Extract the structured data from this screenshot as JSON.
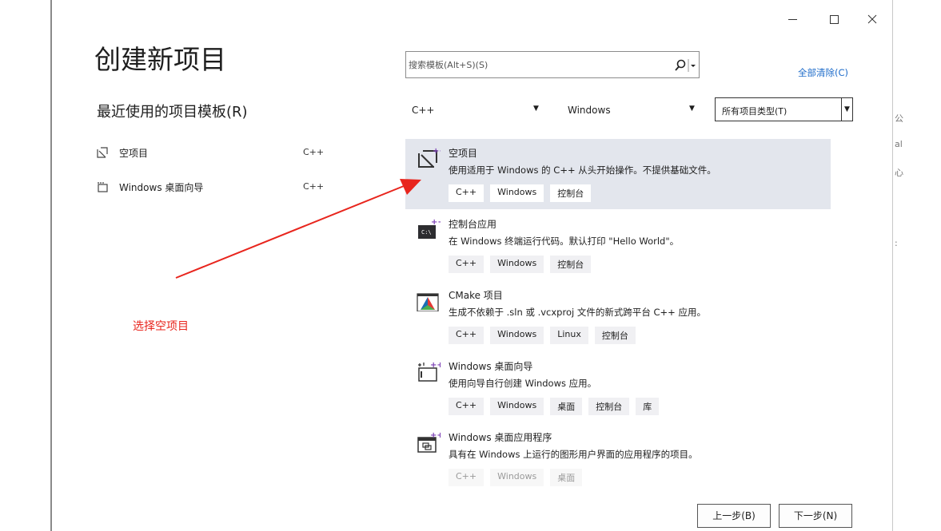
{
  "header": {
    "title": "创建新项目"
  },
  "recent": {
    "title": "最近使用的项目模板(R)",
    "items": [
      {
        "label": "空项目",
        "lang": "C++",
        "icon": "empty-project-icon"
      },
      {
        "label": "Windows 桌面向导",
        "lang": "C++",
        "icon": "desktop-wizard-icon"
      }
    ]
  },
  "search": {
    "placeholder": "搜索模板(Alt+S)(S)",
    "value": ""
  },
  "clear_all": "全部清除(C)",
  "filters": {
    "language": "C++",
    "platform": "Windows",
    "project_type": "所有项目类型(T)"
  },
  "templates": [
    {
      "name": "空项目",
      "desc": "使用适用于 Windows 的 C++ 从头开始操作。不提供基础文件。",
      "tags": [
        "C++",
        "Windows",
        "控制台"
      ],
      "selected": true
    },
    {
      "name": "控制台应用",
      "desc": "在 Windows 终端运行代码。默认打印 \"Hello World\"。",
      "tags": [
        "C++",
        "Windows",
        "控制台"
      ]
    },
    {
      "name": "CMake 项目",
      "desc": "生成不依赖于 .sln 或 .vcxproj 文件的新式跨平台 C++ 应用。",
      "tags": [
        "C++",
        "Windows",
        "Linux",
        "控制台"
      ]
    },
    {
      "name": "Windows 桌面向导",
      "desc": "使用向导自行创建 Windows 应用。",
      "tags": [
        "C++",
        "Windows",
        "桌面",
        "控制台",
        "库"
      ]
    },
    {
      "name": "Windows 桌面应用程序",
      "desc": "具有在 Windows 上运行的图形用户界面的应用程序的项目。",
      "tags": [
        "C++",
        "Windows",
        "桌面"
      ]
    }
  ],
  "annotation": "选择空项目",
  "footer": {
    "back": "上一步(B)",
    "next": "下一步(N)"
  },
  "colors": {
    "accent_link": "#1b6ac9",
    "annotation": "#e8251d",
    "selected_bg": "#e3e6ed"
  }
}
